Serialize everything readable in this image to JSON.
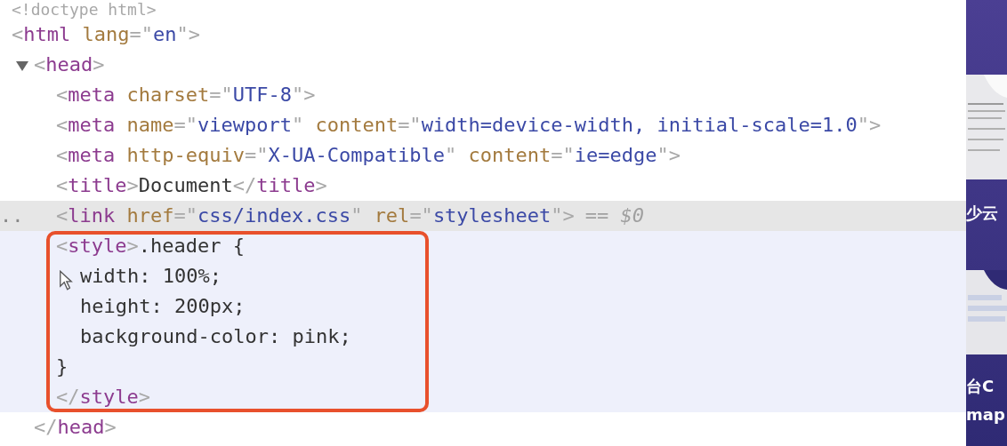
{
  "doctype": [
    {
      "kind": "p",
      "text": "<!doctype html>"
    }
  ],
  "tree": [
    {
      "selected": false,
      "tokens": [
        {
          "kind": "p",
          "text": "<"
        },
        {
          "kind": "tag",
          "text": "html"
        },
        {
          "kind": "attr",
          "text": "lang"
        },
        {
          "kind": "p",
          "text": "=\""
        },
        {
          "kind": "val",
          "text": "en"
        },
        {
          "kind": "p",
          "text": "\">"
        }
      ],
      "children": [
        {
          "selected": false,
          "expanded": true,
          "tokens": [
            {
              "kind": "p",
              "text": "<"
            },
            {
              "kind": "tag",
              "text": "head"
            },
            {
              "kind": "p",
              "text": ">"
            }
          ],
          "children": [
            {
              "selected": false,
              "tokens": [
                {
                  "kind": "p",
                  "text": "<"
                },
                {
                  "kind": "tag",
                  "text": "meta"
                },
                {
                  "kind": "attr",
                  "text": "charset"
                },
                {
                  "kind": "p",
                  "text": "=\""
                },
                {
                  "kind": "val",
                  "text": "UTF-8"
                },
                {
                  "kind": "p",
                  "text": "\">"
                }
              ]
            },
            {
              "selected": false,
              "tokens": [
                {
                  "kind": "p",
                  "text": "<"
                },
                {
                  "kind": "tag",
                  "text": "meta"
                },
                {
                  "kind": "attr",
                  "text": "name"
                },
                {
                  "kind": "p",
                  "text": "=\""
                },
                {
                  "kind": "val",
                  "text": "viewport"
                },
                {
                  "kind": "p",
                  "text": "\""
                },
                {
                  "kind": "attr",
                  "text": "content"
                },
                {
                  "kind": "p",
                  "text": "=\""
                },
                {
                  "kind": "val",
                  "text": "width=device-width, initial-scale=1.0"
                },
                {
                  "kind": "p",
                  "text": "\">"
                }
              ]
            },
            {
              "selected": false,
              "tokens": [
                {
                  "kind": "p",
                  "text": "<"
                },
                {
                  "kind": "tag",
                  "text": "meta"
                },
                {
                  "kind": "attr",
                  "text": "http-equiv"
                },
                {
                  "kind": "p",
                  "text": "=\""
                },
                {
                  "kind": "val",
                  "text": "X-UA-Compatible"
                },
                {
                  "kind": "p",
                  "text": "\""
                },
                {
                  "kind": "attr",
                  "text": "content"
                },
                {
                  "kind": "p",
                  "text": "=\""
                },
                {
                  "kind": "val",
                  "text": "ie=edge"
                },
                {
                  "kind": "p",
                  "text": "\">"
                }
              ]
            },
            {
              "selected": false,
              "tokens": [
                {
                  "kind": "p",
                  "text": "<"
                },
                {
                  "kind": "tag",
                  "text": "title"
                },
                {
                  "kind": "p",
                  "text": ">"
                },
                {
                  "kind": "txt",
                  "text": "Document"
                },
                {
                  "kind": "p",
                  "text": "</"
                },
                {
                  "kind": "tag",
                  "text": "title"
                },
                {
                  "kind": "p",
                  "text": ">"
                }
              ]
            },
            {
              "selected": true,
              "row_marker": "..",
              "tokens": [
                {
                  "kind": "p",
                  "text": "<"
                },
                {
                  "kind": "tag",
                  "text": "link"
                },
                {
                  "kind": "attr",
                  "text": "href"
                },
                {
                  "kind": "p",
                  "text": "=\""
                },
                {
                  "kind": "val",
                  "text": "css/index.css"
                },
                {
                  "kind": "p",
                  "text": "\""
                },
                {
                  "kind": "attr",
                  "text": "rel"
                },
                {
                  "kind": "p",
                  "text": "=\""
                },
                {
                  "kind": "val",
                  "text": "stylesheet"
                },
                {
                  "kind": "p",
                  "text": "\">"
                }
              ],
              "console_ref": "== $0"
            },
            {
              "selected": false,
              "hovered": true,
              "annotated": true,
              "tokens": [
                {
                  "kind": "p",
                  "text": "<"
                },
                {
                  "kind": "tag",
                  "text": "style"
                },
                {
                  "kind": "p",
                  "text": ">"
                },
                {
                  "kind": "txt",
                  "text": ".header {"
                }
              ],
              "text_lines": [
                {
                  "indented": true,
                  "text": "width: 100%;"
                },
                {
                  "indented": true,
                  "text": "height: 200px;"
                },
                {
                  "indented": true,
                  "text": "background-color: pink;"
                },
                {
                  "indented": false,
                  "text": "}"
                }
              ],
              "closing": [
                {
                  "kind": "p",
                  "text": "</"
                },
                {
                  "kind": "tag",
                  "text": "style"
                },
                {
                  "kind": "p",
                  "text": ">"
                }
              ]
            }
          ],
          "closing": [
            {
              "kind": "p",
              "text": "</"
            },
            {
              "kind": "tag",
              "text": "head"
            },
            {
              "kind": "p",
              "text": ">"
            }
          ]
        }
      ]
    }
  ],
  "side_panel": {
    "captions": [
      "少云",
      "台C",
      "map"
    ]
  }
}
